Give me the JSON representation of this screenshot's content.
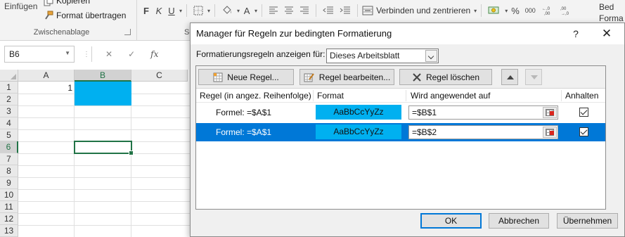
{
  "ribbon": {
    "paste_label": "Einfügen",
    "copy_label": "Kopieren",
    "format_painter_label": "Format übertragen",
    "clipboard_group": "Zwischenablage",
    "bold": "F",
    "italic": "K",
    "underline": "U",
    "font_color": "A",
    "merge_label": "Verbinden und zentrieren",
    "percent": "%",
    "thousands": "000",
    "next_group_partial": "Sc",
    "right_partial_1": "Bed",
    "right_partial_2": "Forma"
  },
  "formula_bar": {
    "name_box": "B6",
    "fx": "fx"
  },
  "sheet": {
    "columns": [
      "A",
      "B",
      "C"
    ],
    "rows": [
      "1",
      "2",
      "3",
      "4",
      "5",
      "6",
      "7",
      "8",
      "9",
      "10",
      "11",
      "12",
      "13"
    ],
    "cell_a1": "1",
    "active_cell": "B6",
    "fill_color": "#00b0f0"
  },
  "dialog": {
    "title": "Manager für Regeln zur bedingten Formatierung",
    "help": "?",
    "close": "✕",
    "show_rules_label": "Formatierungsregeln anzeigen für:",
    "show_rules_value": "Dieses Arbeitsblatt",
    "buttons": {
      "new_rule": "Neue Regel...",
      "edit_rule": "Regel bearbeiten...",
      "delete_rule": "Regel löschen"
    },
    "columns": {
      "rule": "Regel (in angez. Reihenfolge)",
      "format": "Format",
      "applies_to": "Wird angewendet auf",
      "stop": "Anhalten"
    },
    "rules": [
      {
        "label": "Formel: =$A$1",
        "preview": "AaBbCcYyZz",
        "applies_to": "=$B$1",
        "stop_if_true": true,
        "selected": false
      },
      {
        "label": "Formel: =$A$1",
        "preview": "AaBbCcYyZz",
        "applies_to": "=$B$2",
        "stop_if_true": true,
        "selected": true
      }
    ],
    "footer": {
      "ok": "OK",
      "cancel": "Abbrechen",
      "apply": "Übernehmen"
    }
  },
  "colors": {
    "selection_blue": "#0078d7",
    "excel_green": "#217346",
    "format_fill": "#00b0f0"
  }
}
